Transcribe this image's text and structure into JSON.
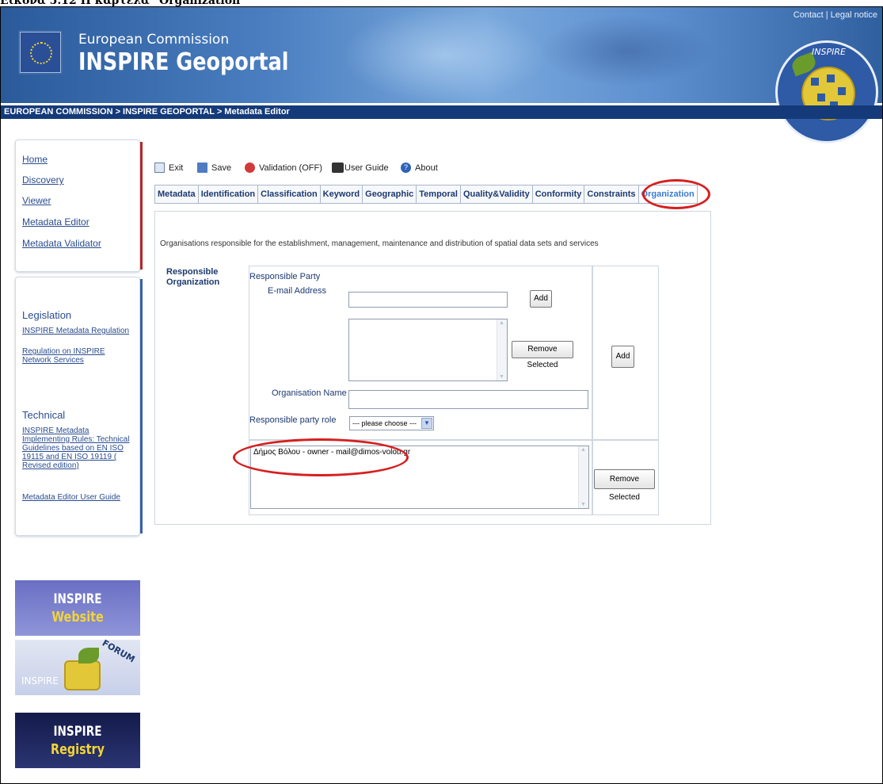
{
  "caption": "Εικόνα 5.12 Η καρτέλα \"Organization\"",
  "header": {
    "brand_top": "European Commission",
    "brand_main": "INSPIRE Geoportal",
    "contact": "Contact",
    "legal": "Legal notice",
    "logo_text": "INSPIRE"
  },
  "breadcrumb": "EUROPEAN COMMISSION > INSPIRE GEOPORTAL > Metadata Editor",
  "nav": [
    "Home",
    "Discovery",
    "Viewer",
    "Metadata Editor",
    "Metadata Validator"
  ],
  "sidebar": {
    "legislation_title": "Legislation",
    "legislation_links": [
      "INSPIRE Metadata Regulation",
      "Regulation on INSPIRE Network Services"
    ],
    "technical_title": "Technical",
    "technical_links": [
      "INSPIRE Metadata Implementing Rules: Technical Guidelines based on EN ISO 19115 and EN ISO 19119 ( Revised edition)",
      "Metadata Editor User Guide"
    ]
  },
  "banners": {
    "website": [
      "INSPIRE",
      "Website"
    ],
    "forum": [
      "INSPIRE",
      "FORUM"
    ],
    "registry": [
      "INSPIRE",
      "Registry"
    ]
  },
  "toolbar": {
    "exit": "Exit",
    "save": "Save",
    "validation": "Validation (OFF)",
    "user_guide": "User Guide",
    "about": "About"
  },
  "tabs": [
    "Metadata",
    "Identification",
    "Classification",
    "Keyword",
    "Geographic",
    "Temporal",
    "Quality&Validity",
    "Conformity",
    "Constraints",
    "Organization"
  ],
  "content": {
    "intro": "Organisations responsible for the establishment, management, maintenance and distribution of spatial data sets and services",
    "resp_org": [
      "Responsible",
      "Organization"
    ],
    "resp_party": "Responsible Party",
    "email_label": "E-mail Address",
    "email_value": "",
    "add_label": "Add",
    "remove_selected": "Remove Selected",
    "org_name_label": "Organisation Name",
    "org_name_value": "",
    "role_label": "Responsible party role",
    "role_selected": "--- please choose ---",
    "add_outer": "Add",
    "result_item": "Δήμος Βόλου - owner - mail@dimos-volou.gr",
    "remove_selected_2": "Remove Selected"
  },
  "colors": {
    "annotation": "#d61f1f",
    "active_tab": "#3b7bd1",
    "breadcrumb_bg": "#143a7a"
  }
}
